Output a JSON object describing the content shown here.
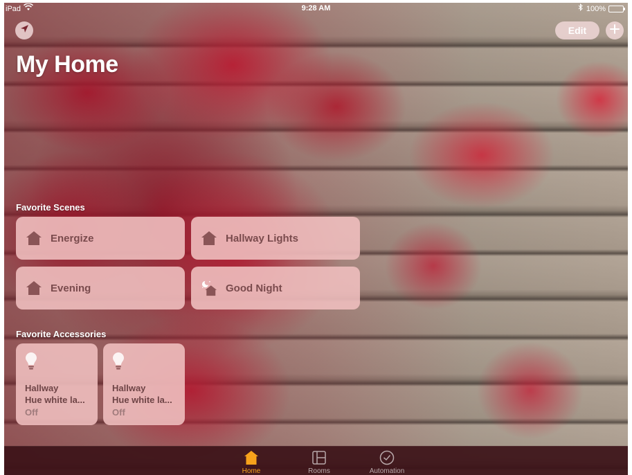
{
  "status_bar": {
    "device": "iPad",
    "time": "9:28 AM",
    "battery": "100%",
    "icons": [
      "wifi-icon",
      "bluetooth-icon",
      "battery-icon"
    ]
  },
  "header": {
    "title": "My Home",
    "edit_label": "Edit",
    "location_icon": "location-arrow-icon",
    "add_icon": "plus-icon"
  },
  "scenes": {
    "title": "Favorite Scenes",
    "items": [
      {
        "label": "Energize",
        "icon": "house-icon"
      },
      {
        "label": "Hallway Lights",
        "icon": "house-icon"
      },
      {
        "label": "Evening",
        "icon": "house-icon"
      },
      {
        "label": "Good Night",
        "icon": "moon-house-icon"
      }
    ]
  },
  "accessories": {
    "title": "Favorite Accessories",
    "items": [
      {
        "name": "Hallway",
        "subtitle": "Hue white la...",
        "status": "Off",
        "icon": "lightbulb-icon"
      },
      {
        "name": "Hallway",
        "subtitle": "Hue white la...",
        "status": "Off",
        "icon": "lightbulb-icon"
      }
    ]
  },
  "tabs": [
    {
      "label": "Home",
      "icon": "home-tab-icon",
      "selected": true
    },
    {
      "label": "Rooms",
      "icon": "rooms-tab-icon",
      "selected": false
    },
    {
      "label": "Automation",
      "icon": "automation-tab-icon",
      "selected": false
    }
  ],
  "colors": {
    "accent": "#f7a21b",
    "tile_background": "#eebebe",
    "tile_text": "#7a4b4d",
    "tab_bar": "#3c1218"
  }
}
